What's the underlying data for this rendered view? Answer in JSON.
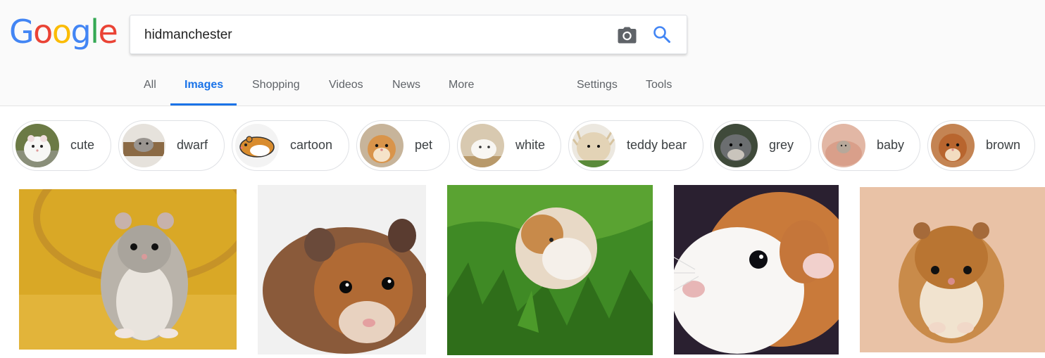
{
  "logo": {
    "letters": [
      "G",
      "o",
      "o",
      "g",
      "l",
      "e"
    ],
    "colors": [
      "#4285F4",
      "#EA4335",
      "#FBBC05",
      "#4285F4",
      "#34A853",
      "#EA4335"
    ]
  },
  "search": {
    "query": "hidmanchester",
    "camera_icon": "camera-icon",
    "search_icon": "search-icon"
  },
  "tabs": {
    "all": "All",
    "images": "Images",
    "shopping": "Shopping",
    "videos": "Videos",
    "news": "News",
    "more": "More",
    "settings": "Settings",
    "tools": "Tools"
  },
  "chips": [
    "cute",
    "dwarf",
    "cartoon",
    "pet",
    "white",
    "teddy bear",
    "grey",
    "baby",
    "brown"
  ],
  "colors": {
    "accent": "#1a73e8",
    "tab_text": "#5f6368",
    "chip_border": "#dfe1e5"
  }
}
